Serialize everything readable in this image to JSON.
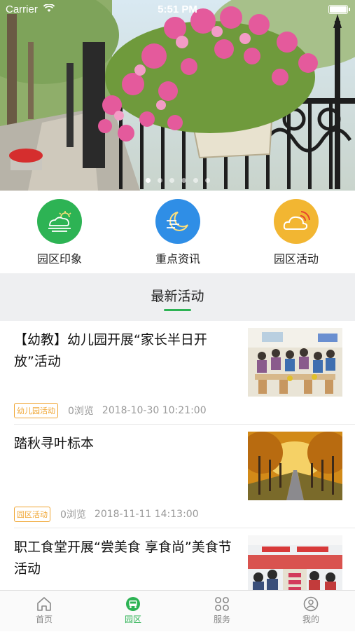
{
  "status_bar": {
    "carrier": "Carrier",
    "time": "5:51 PM"
  },
  "banner": {
    "dot_count": 6,
    "active_dot": 0
  },
  "quick_links": [
    {
      "label": "园区印象",
      "icon": "weather-sun-cloud-icon",
      "color": "#2db354"
    },
    {
      "label": "重点资讯",
      "icon": "moon-wind-icon",
      "color": "#2f8ee6"
    },
    {
      "label": "园区活动",
      "icon": "cloud-signal-icon",
      "color": "#f2b632"
    }
  ],
  "section": {
    "title": "最新活动",
    "accent": "#2db354"
  },
  "activities": [
    {
      "title": "【幼教】幼儿园开展“家长半日开放”活动",
      "tag": "幼儿园活动",
      "views": "0浏览",
      "date": "2018-10-30 10:21:00",
      "image": "classroom-photo"
    },
    {
      "title": "踏秋寻叶标本",
      "tag": "园区活动",
      "views": "0浏览",
      "date": "2018-11-11 14:13:00",
      "image": "autumn-road-photo"
    },
    {
      "title": "职工食堂开展“尝美食 享食尚”美食节活动",
      "tag": "",
      "views": "",
      "date": "",
      "image": "canteen-photo"
    }
  ],
  "tab_bar": [
    {
      "label": "首页",
      "icon": "home-icon",
      "active": false
    },
    {
      "label": "园区",
      "icon": "park-bus-icon",
      "active": true
    },
    {
      "label": "服务",
      "icon": "grid-services-icon",
      "active": false
    },
    {
      "label": "我的",
      "icon": "user-icon",
      "active": false
    }
  ],
  "colors": {
    "accent_green": "#2db354",
    "tag_orange": "#f0a531"
  }
}
